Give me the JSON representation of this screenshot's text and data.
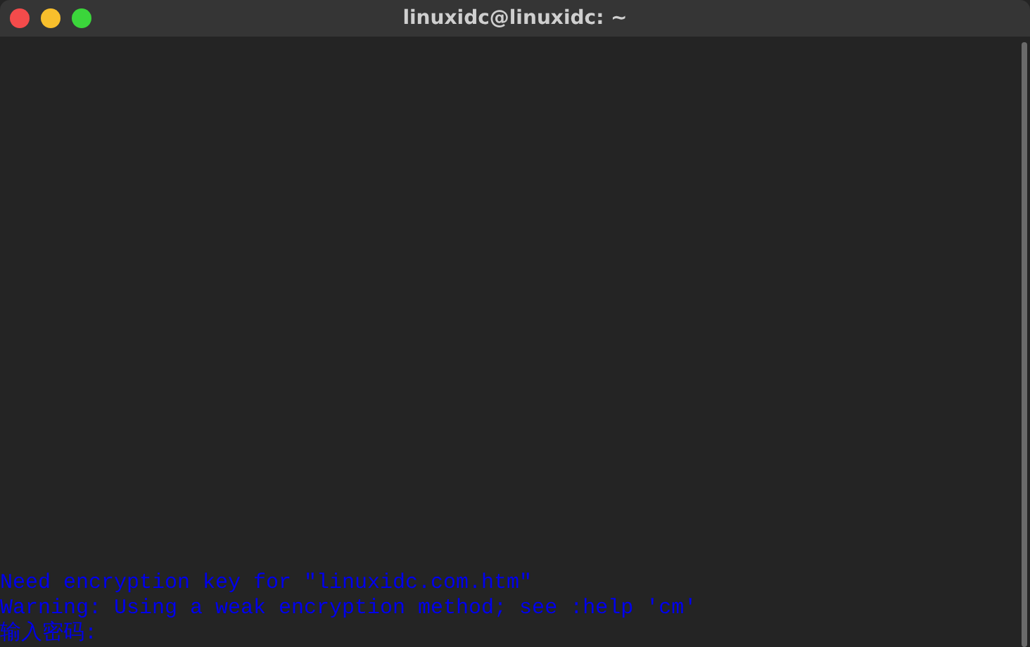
{
  "window": {
    "title": "linuxidc@linuxidc: ~"
  },
  "terminal": {
    "lines": [
      {
        "text": "Need encryption key for \"linuxidc.com.htm\""
      },
      {
        "text": "Warning: Using a weak encryption method; see :help 'cm'"
      },
      {
        "text": "输入密码:"
      }
    ]
  }
}
